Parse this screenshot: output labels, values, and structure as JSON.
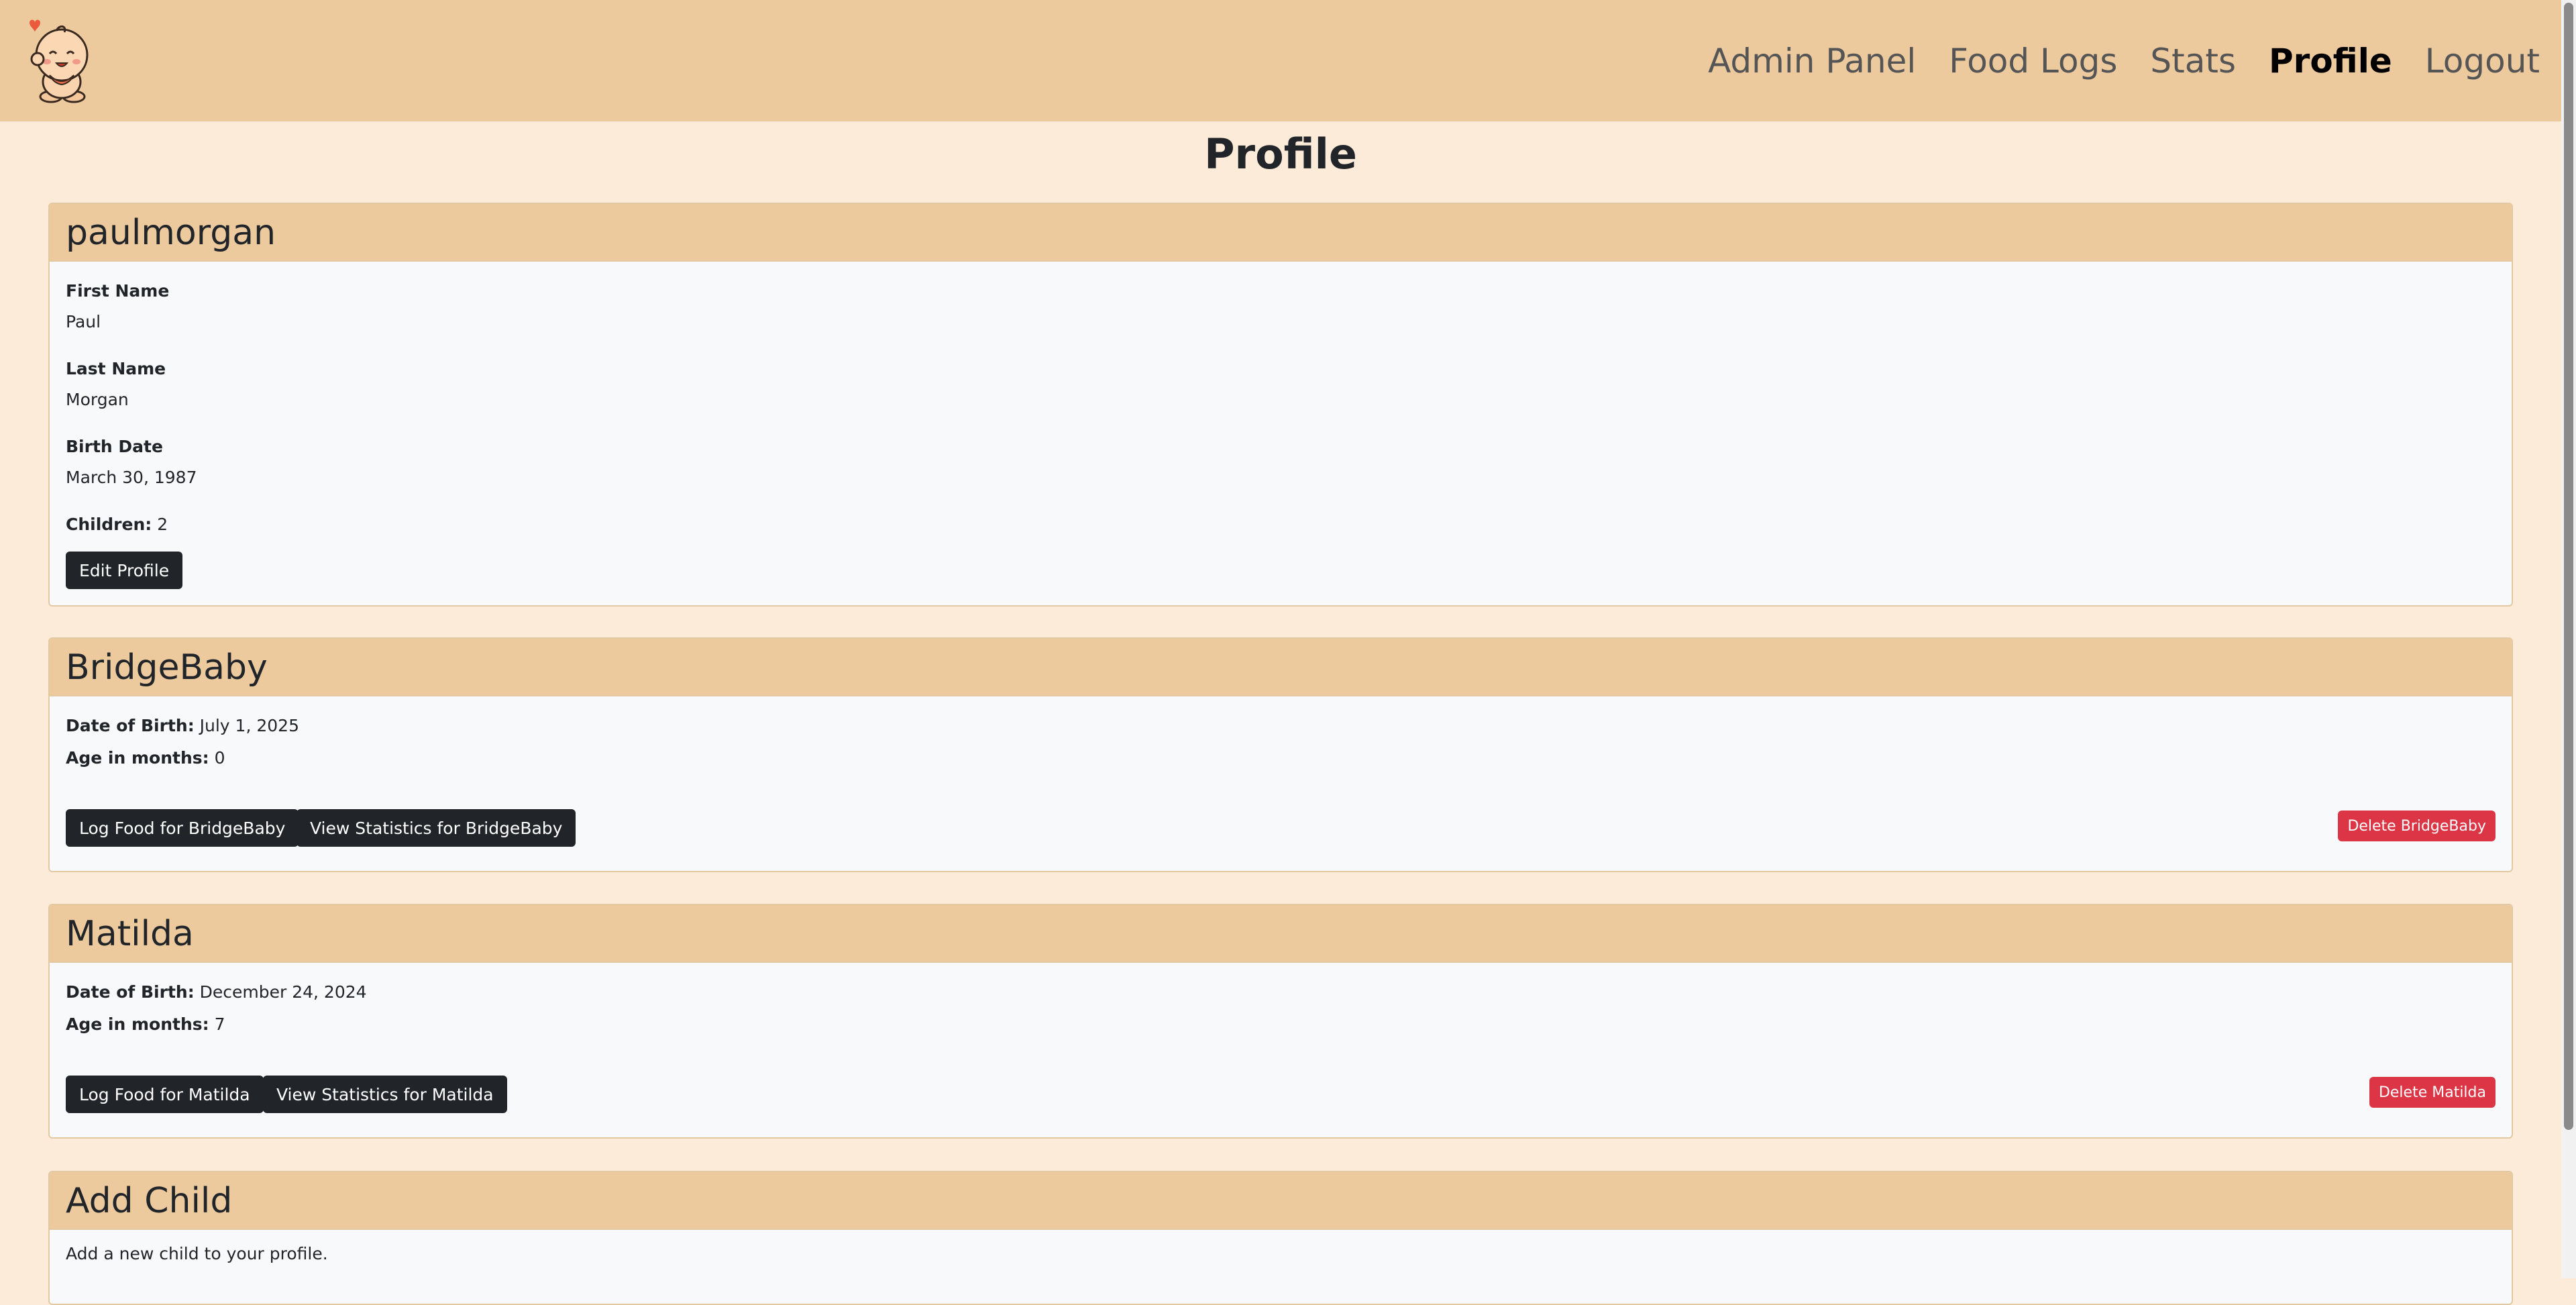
{
  "nav": {
    "items": [
      {
        "label": "Admin Panel",
        "active": false
      },
      {
        "label": "Food Logs",
        "active": false
      },
      {
        "label": "Stats",
        "active": false
      },
      {
        "label": "Profile",
        "active": true
      },
      {
        "label": "Logout",
        "active": false
      }
    ]
  },
  "page": {
    "title": "Profile"
  },
  "user": {
    "username": "paulmorgan",
    "first_name_label": "First Name",
    "first_name": "Paul",
    "last_name_label": "Last Name",
    "last_name": "Morgan",
    "birth_date_label": "Birth Date",
    "birth_date": "March 30, 1987",
    "children_label": "Children:",
    "children_count": "2",
    "edit_button": "Edit Profile"
  },
  "children": [
    {
      "name": "BridgeBaby",
      "dob_label": "Date of Birth:",
      "dob": "July 1, 2025",
      "age_label": "Age in months:",
      "age": "0",
      "log_button": "Log Food for BridgeBaby",
      "stats_button": "View Statistics for BridgeBaby",
      "delete_button": "Delete BridgeBaby"
    },
    {
      "name": "Matilda",
      "dob_label": "Date of Birth:",
      "dob": "December 24, 2024",
      "age_label": "Age in months:",
      "age": "7",
      "log_button": "Log Food for Matilda",
      "stats_button": "View Statistics for Matilda",
      "delete_button": "Delete Matilda"
    }
  ],
  "add_child": {
    "title": "Add Child",
    "description": "Add a new child to your profile."
  },
  "colors": {
    "background": "#fdebd9",
    "header": "#edca9e",
    "button_dark": "#212529",
    "button_danger": "#dc3545"
  },
  "icons": {
    "logo": "baby-logo-icon",
    "heart": "heart-icon"
  }
}
